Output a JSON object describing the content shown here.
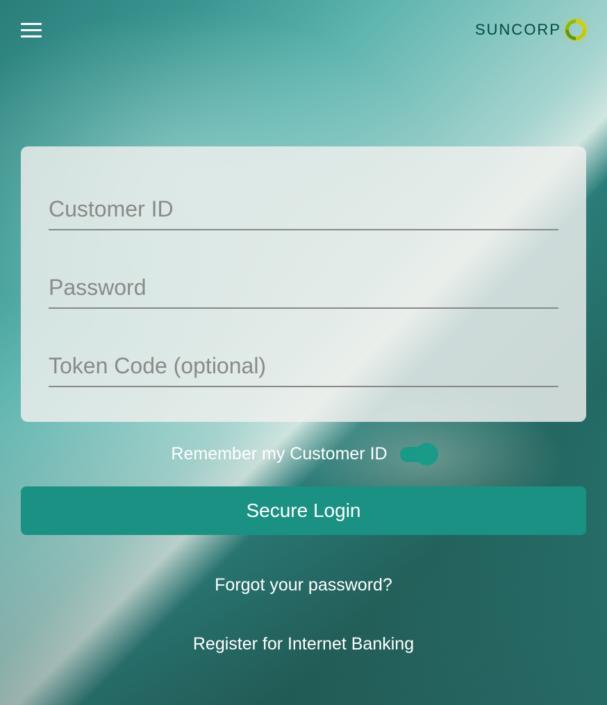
{
  "header": {
    "brand_name": "SUNCORP"
  },
  "login": {
    "customer_id_placeholder": "Customer ID",
    "password_placeholder": "Password",
    "token_placeholder": "Token Code (optional)",
    "customer_id_value": "",
    "password_value": "",
    "token_value": ""
  },
  "remember": {
    "label": "Remember my Customer ID",
    "enabled": true
  },
  "actions": {
    "login_button": "Secure Login",
    "forgot_password": "Forgot your password?",
    "register": "Register for Internet Banking"
  }
}
